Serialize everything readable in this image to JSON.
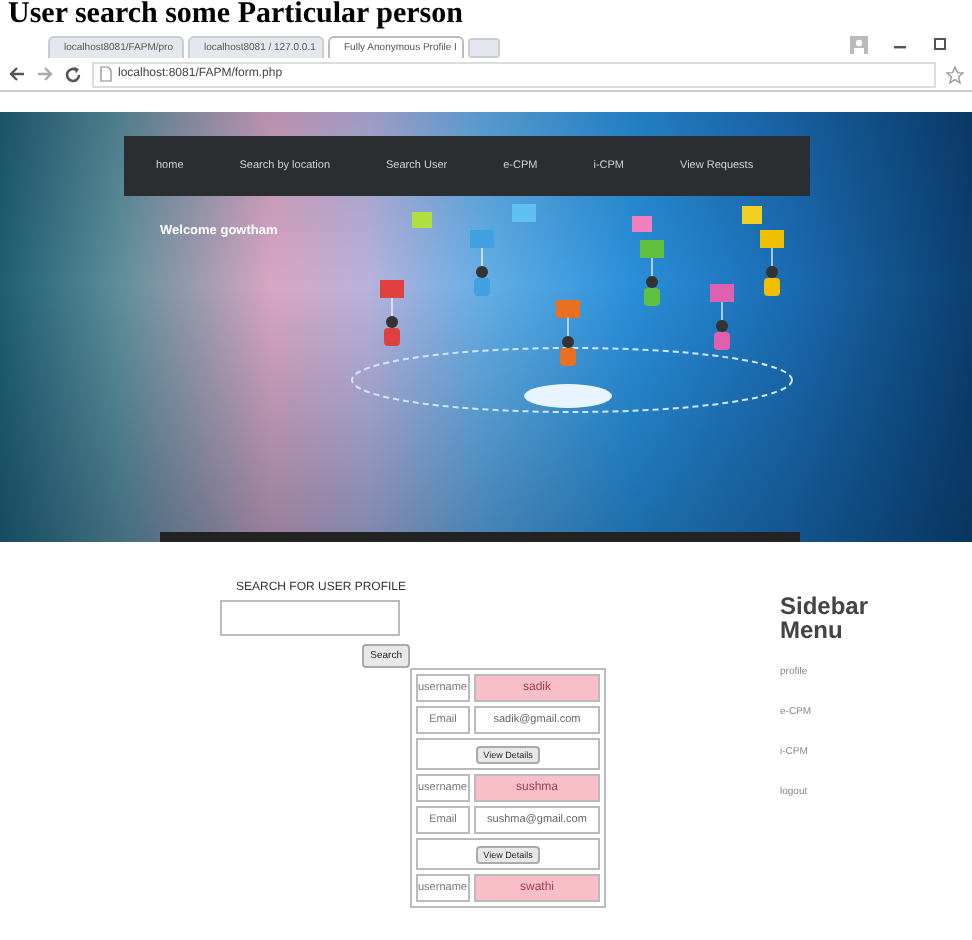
{
  "caption": "User search some Particular person",
  "tabs": [
    {
      "label": "localhost8081/FAPM/pro",
      "selected": false
    },
    {
      "label": "localhost8081 / 127.0.0.1",
      "selected": false
    },
    {
      "label": "Fully Anonymous Profile I",
      "selected": true
    }
  ],
  "address": "localhost:8081/FAPM/form.php",
  "nav": [
    "home",
    "Search by location",
    "Search User",
    "e-CPM",
    "i-CPM",
    "View Requests"
  ],
  "welcome": "Welcome gowtham",
  "search": {
    "title": "SEARCH FOR USER PROFILE",
    "button": "Search"
  },
  "results": [
    {
      "username_label": "username",
      "username": "sadik",
      "email_label": "Email",
      "email": "sadik@gmail.com",
      "button": "View Details"
    },
    {
      "username_label": "username",
      "username": "sushma",
      "email_label": "Email",
      "email": "sushma@gmail.com",
      "button": "View Details"
    },
    {
      "username_label": "username",
      "username": "swathi"
    }
  ],
  "sidebar": {
    "title": "Sidebar Menu",
    "items": [
      "profile",
      "e-CPM",
      "i-CPM",
      "logout"
    ]
  }
}
